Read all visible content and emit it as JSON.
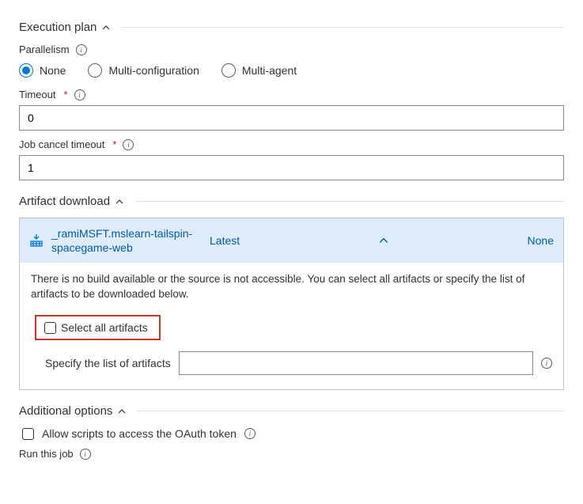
{
  "sections": {
    "execution_plan": "Execution plan",
    "artifact_download": "Artifact download",
    "additional_options": "Additional options"
  },
  "parallelism": {
    "label": "Parallelism",
    "options": {
      "none": "None",
      "multi_config": "Multi-configuration",
      "multi_agent": "Multi-agent"
    },
    "selected": "none"
  },
  "timeout": {
    "label": "Timeout",
    "value": "0"
  },
  "job_cancel_timeout": {
    "label": "Job cancel timeout",
    "value": "1"
  },
  "artifact": {
    "name": "_ramiMSFT.mslearn-tailspin-spacegame-web",
    "version_selector": "Latest",
    "specific_artifact": "None",
    "description": "There is no build available or the source is not accessible. You can select all artifacts or specify the list of artifacts to be downloaded below.",
    "select_all_label": "Select all artifacts",
    "specify_label": "Specify the list of artifacts",
    "specify_value": ""
  },
  "additional": {
    "oauth_label": "Allow scripts to access the OAuth token",
    "run_job_label": "Run this job"
  }
}
